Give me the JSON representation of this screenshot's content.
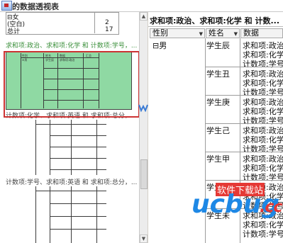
{
  "window": {
    "title": "的数据透视表"
  },
  "left": {
    "top_table": {
      "rows": [
        {
          "label": "⊟女",
          "value": ""
        },
        {
          "label": "  (空白)",
          "value": "2"
        },
        {
          "label": "总计",
          "value": "17"
        }
      ]
    },
    "sections": [
      {
        "label": "求和项:政治、求和项:化学 和 计数项:学号，...",
        "active": true
      },
      {
        "label": "计数项:化学、求和项:英语 和 求和项:总分，...",
        "active": false
      },
      {
        "label": "计数项:学号、求和项:英语 和 求和项:总分，...",
        "active": false
      }
    ],
    "preview_headers": [
      "性别",
      "姓名",
      "数据",
      "汇总"
    ],
    "preview_first_row": [
      "⊟男",
      "学生辰",
      "求和项:政治"
    ]
  },
  "right": {
    "header": "求和项:政治、求和项:化学 和 计数...",
    "columns": [
      {
        "label": "性别",
        "dropdown": "▼"
      },
      {
        "label": "姓名",
        "dropdown": "▼"
      },
      {
        "label": "数据",
        "dropdown": ""
      }
    ],
    "gender": "⊟男",
    "students": [
      "学生辰",
      "学生丑",
      "学生庚",
      "学生己",
      "学生甲",
      "学生卯",
      "学生未"
    ],
    "data_items": [
      "求和项:政治",
      "求和项:化学",
      "计数项:学号"
    ]
  },
  "watermark": {
    "brand": "ucbug",
    "domain": ".cc",
    "cn": "软件下载站"
  }
}
